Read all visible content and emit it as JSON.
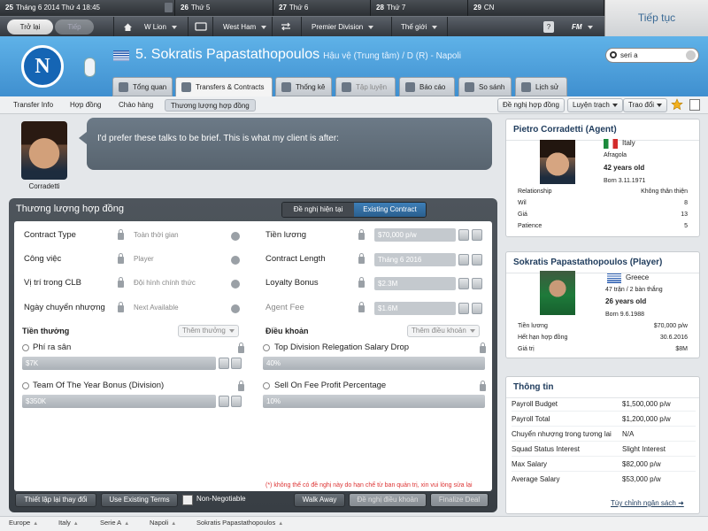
{
  "datebar": [
    {
      "day": "25",
      "text": "Tháng 6 2014 Thứ 4 18:45"
    },
    {
      "day": "26",
      "text": "Thứ 5"
    },
    {
      "day": "27",
      "text": "Thứ 6"
    },
    {
      "day": "28",
      "text": "Thứ 7"
    },
    {
      "day": "29",
      "text": "CN"
    }
  ],
  "toolbar": {
    "back": "Trở lại",
    "next": "Tiếp",
    "manager": "W Lion",
    "club": "West Ham",
    "league": "Premier Division",
    "world": "Thế giới",
    "fm": "FM",
    "help": "?",
    "continue": "Tiếp tục"
  },
  "player": {
    "number_name": "5. Sokratis Papastathopoulos",
    "position": "Hậu vệ (Trung tâm) / D (R) - Napoli",
    "club_logo": "N"
  },
  "search": {
    "value": "seri a"
  },
  "tabs": [
    "Tổng quan",
    "Transfers & Contracts",
    "Thống kê",
    "Tập luyện",
    "Báo cáo",
    "So sánh",
    "Lịch sử"
  ],
  "subtabs": [
    "Transfer Info",
    "Hợp đồng",
    "Chào hàng",
    "Thương lượng hợp đồng"
  ],
  "right_buttons": {
    "offer": "Đề nghị hợp đồng",
    "scout": "Luyện trạch",
    "exchange": "Trao đổi"
  },
  "speech": {
    "name": "Corradetti",
    "text": "I'd prefer these talks to be brief. This is what my client is after:"
  },
  "contract": {
    "title": "Thương lượng hợp đồng",
    "toggle": [
      "Đề nghị hiện tại",
      "Existing Contract"
    ],
    "left_fields": [
      {
        "label": "Contract Type",
        "value": "Toàn thời gian"
      },
      {
        "label": "Công việc",
        "value": "Player"
      },
      {
        "label": "Vị trí trong CLB",
        "value": "Đội hình chính thức"
      },
      {
        "label": "Ngày chuyển nhượng",
        "value": "Next Available"
      }
    ],
    "right_fields": [
      {
        "label": "Tiền lương",
        "value": "$70,000 p/w"
      },
      {
        "label": "Contract Length",
        "value": "Tháng 6 2016"
      },
      {
        "label": "Loyalty Bonus",
        "value": "$2.3M"
      },
      {
        "label": "Agent Fee",
        "value": "$1.6M"
      }
    ],
    "bonus_title": "Tiền thưởng",
    "bonus_add": "Thêm thưởng",
    "clause_title": "Điều khoản",
    "clause_add": "Thêm điều khoản",
    "bonuses": [
      {
        "label": "Phí ra sân",
        "value": "$7K"
      },
      {
        "label": "Team Of The Year Bonus (Division)",
        "value": "$350K"
      }
    ],
    "clauses": [
      {
        "label": "Top Division Relegation Salary Drop",
        "value": "40%"
      },
      {
        "label": "Sell On Fee Profit Percentage",
        "value": "10%"
      }
    ],
    "disclaimer": "(*) không thể có đề nghị này do hạn chế từ ban quản trị, xin vui lòng sửa lại",
    "buttons": {
      "reset": "Thiết lập lại thay đổi",
      "existing": "Use Existing Terms",
      "nonneg": "Non-Negotiable",
      "walk": "Walk Away",
      "propose": "Đề nghị điều khoản",
      "finalize": "Finalize Deal"
    }
  },
  "agent_card": {
    "title": "Pietro Corradetti (Agent)",
    "country": "Italy",
    "city": "Afragola",
    "age": "42 years old",
    "born": "Born 3.11.1971",
    "rows": [
      {
        "k": "Relationship",
        "v": "Không thân thiện"
      },
      {
        "k": "Wil",
        "v": "8"
      },
      {
        "k": "Giá",
        "v": "13"
      },
      {
        "k": "Patience",
        "v": "5"
      }
    ]
  },
  "player_card": {
    "title": "Sokratis Papastathopoulos (Player)",
    "country": "Greece",
    "apps": "47 trận / 2 bàn thắng",
    "age": "26 years old",
    "born": "Born 9.6.1988",
    "rows": [
      {
        "k": "Tiền lương",
        "v": "$70,000 p/w"
      },
      {
        "k": "Hết hạn hợp đồng",
        "v": "30.6.2016"
      },
      {
        "k": "Giá trị",
        "v": "$8M"
      }
    ]
  },
  "finance": {
    "title": "Thông tin",
    "rows": [
      {
        "k": "Payroll Budget",
        "v": "$1,500,000 p/w"
      },
      {
        "k": "Payroll Total",
        "v": "$1,200,000 p/w"
      },
      {
        "k": "Chuyển nhượng trong tương lai",
        "v": "N/A"
      },
      {
        "k": "Squad Status Interest",
        "v": "Slight Interest"
      },
      {
        "k": "Max Salary",
        "v": "$82,000 p/w"
      },
      {
        "k": "Average Salary",
        "v": "$53,000 p/w"
      }
    ],
    "link": "Tùy chỉnh ngân sách"
  },
  "breadcrumb": [
    "Europe",
    "Italy",
    "Serie A",
    "Napoli",
    "Sokratis Papastathopoulos"
  ]
}
